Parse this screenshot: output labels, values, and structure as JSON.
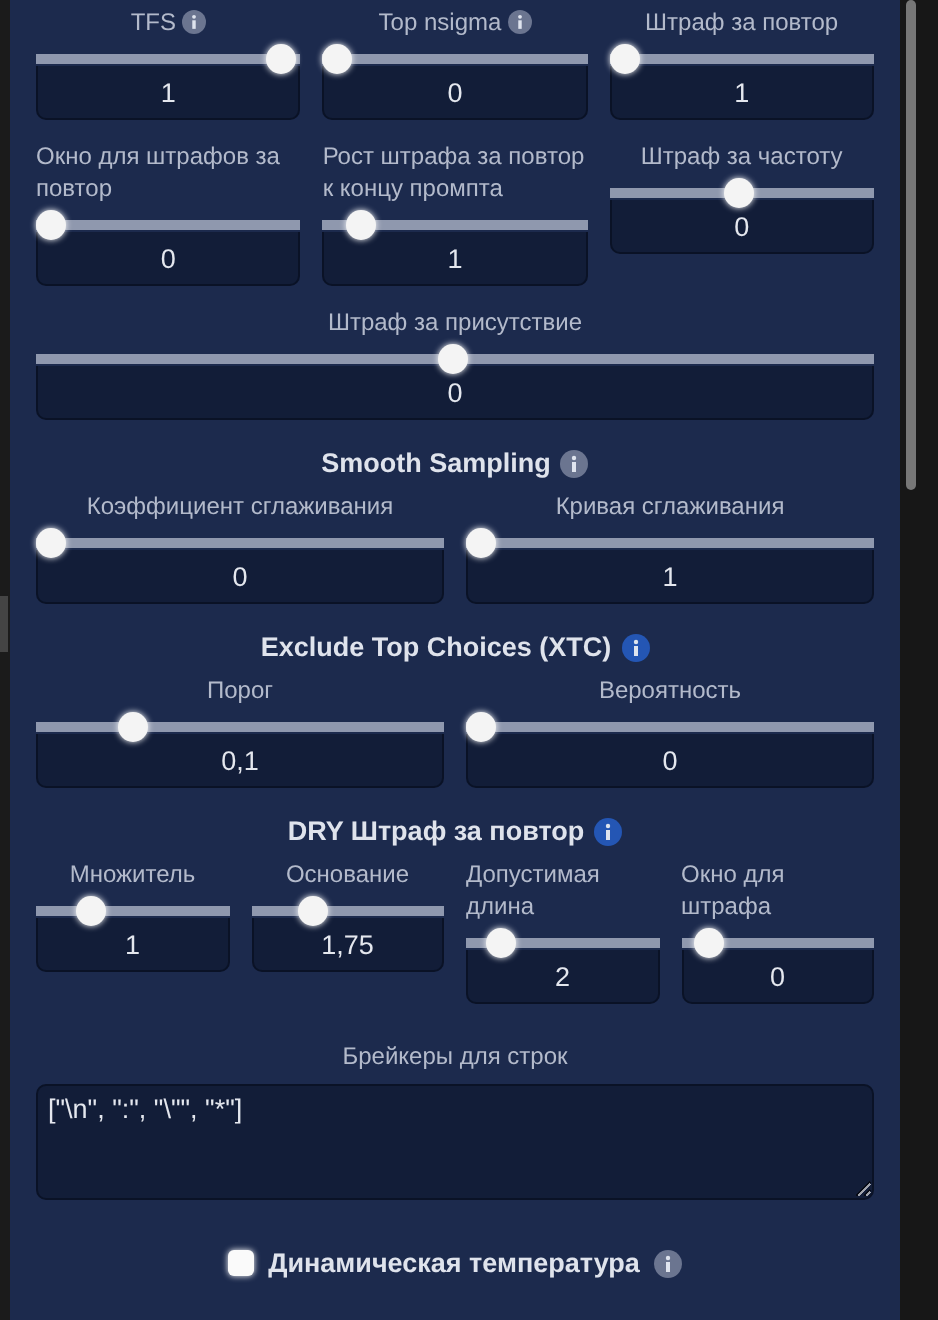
{
  "sections": [
    {
      "kind": "sliders",
      "rows": [
        [
          {
            "label": "TFS",
            "info": {
              "color": "#6b7590"
            },
            "level": 1,
            "value": "1"
          },
          {
            "label": "Top nsigma",
            "info": {
              "color": "#6b7590"
            },
            "level": 0,
            "value": "0"
          },
          {
            "label": "Штраф за повтор",
            "level": 0,
            "value": "1"
          }
        ],
        [
          {
            "label": "Окно для штрафов за повтор",
            "level": 0,
            "value": "0"
          },
          {
            "label": "Рост штрафа за повтор к концу промпта",
            "level": 0.1,
            "value": "1"
          },
          {
            "label": "Штраф за частоту",
            "level": 0.5,
            "value": "0"
          }
        ]
      ]
    },
    {
      "kind": "sliders",
      "rows": [
        [
          {
            "label": "Штраф за присутствие",
            "level": 0.5,
            "value": "0"
          }
        ]
      ]
    },
    {
      "kind": "sliders",
      "title": "Smooth Sampling",
      "info": {
        "color": "#6b7590"
      },
      "rows": [
        [
          {
            "label": "Коэффициент сглаживания",
            "level": 0,
            "value": "0"
          },
          {
            "label": "Кривая сглаживания",
            "level": 0,
            "value": "1"
          }
        ]
      ]
    },
    {
      "kind": "sliders",
      "title": "Exclude Top Choices (XTC)",
      "info": {
        "color": "#2456b4"
      },
      "rows": [
        [
          {
            "label": "Порог",
            "level": 0.22,
            "value": "0,1"
          },
          {
            "label": "Вероятность",
            "level": 0,
            "value": "0"
          }
        ]
      ]
    },
    {
      "kind": "sliders",
      "title": "DRY Штраф за повтор",
      "info": {
        "color": "#2456b4"
      },
      "rows": [
        [
          {
            "label": "Множитель",
            "level": 0.25,
            "value": "1"
          },
          {
            "label": "Основание",
            "level": 0.3,
            "value": "1,75"
          },
          {
            "label": "Допустимая длина",
            "level": 0.12,
            "value": "2"
          },
          {
            "label": "Окно для штрафа",
            "level": 0.08,
            "value": "0"
          }
        ]
      ]
    },
    {
      "kind": "text",
      "label": "Брейкеры для строк",
      "value": "[\"\\n\", \":\", \"\\\"\", \"*\"]"
    },
    {
      "kind": "toggle",
      "label": "Динамическая температура",
      "checked": false,
      "info": {
        "color": "#6b7590"
      }
    }
  ]
}
